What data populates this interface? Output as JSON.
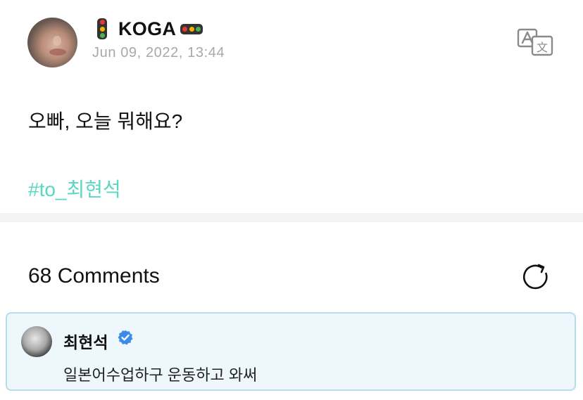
{
  "post": {
    "author": "KOGA",
    "timestamp": "Jun 09, 2022, 13:44",
    "text": "오빠, 오늘 뭐해요?",
    "hashtag": "#to_최현석",
    "translate_icon": "translate-icon"
  },
  "comments": {
    "header": "68 Comments",
    "refresh_icon": "refresh-icon",
    "items": [
      {
        "author": "최현석",
        "verified": true,
        "text": "일본어수업하구 운동하고 와써"
      }
    ]
  },
  "colors": {
    "hashtag": "#5ad7c1",
    "timestamp": "#a8a8a8",
    "comment_bg": "#edf7fc",
    "comment_border": "#b7dcea",
    "verified": "#3d8be8"
  }
}
